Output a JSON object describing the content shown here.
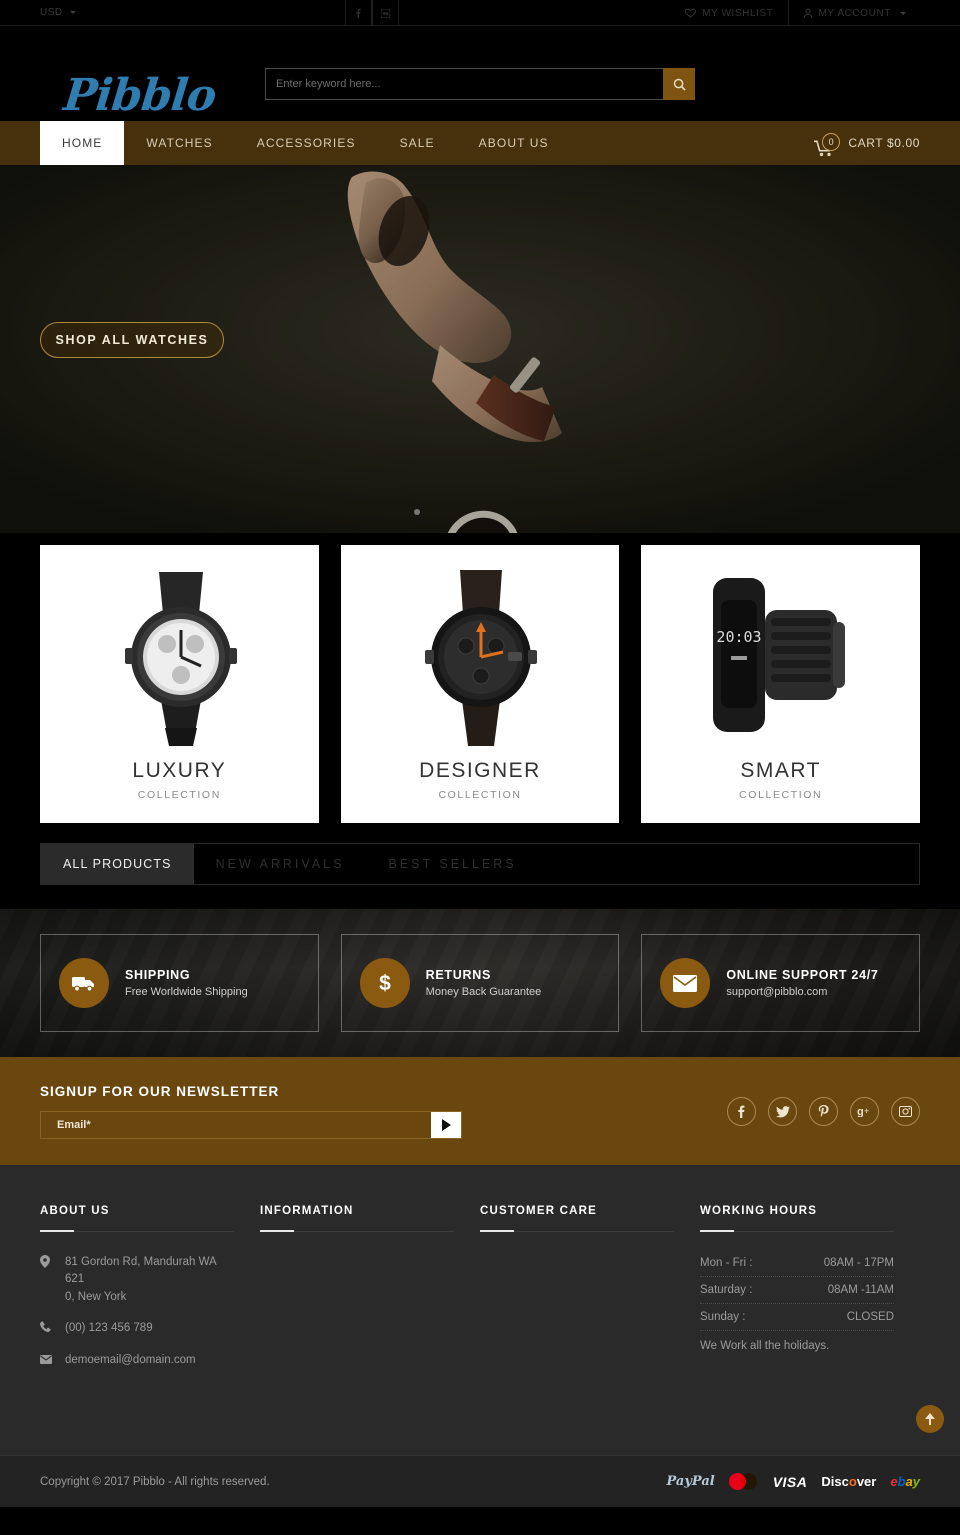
{
  "topbar": {
    "currency": "USD",
    "social": [
      "facebook-icon",
      "flickr-icon"
    ],
    "wishlist": "MY WISHLIST",
    "account": "MY ACCOUNT"
  },
  "header": {
    "logo": "Pibblo",
    "search": {
      "placeholder": "Enter keyword here...",
      "value": "",
      "icon": "search-icon"
    }
  },
  "nav": {
    "items": [
      {
        "label": "HOME",
        "active": true
      },
      {
        "label": "WATCHES",
        "active": false
      },
      {
        "label": "ACCESSORIES",
        "active": false
      },
      {
        "label": "SALE",
        "active": false
      },
      {
        "label": "ABOUT US",
        "active": false
      }
    ],
    "cart": {
      "count": "0",
      "label": "CART $0.00",
      "icon": "cart-icon"
    }
  },
  "hero": {
    "cta": "SHOP ALL WATCHES",
    "alt": "hands-holding-wrist-watch"
  },
  "collections": [
    {
      "title": "LUXURY",
      "subtitle": "COLLECTION",
      "art": "chronograph-steel-watch"
    },
    {
      "title": "DESIGNER",
      "subtitle": "COLLECTION",
      "art": "orange-accent-pilot-watch"
    },
    {
      "title": "SMART",
      "subtitle": "COLLECTION",
      "art": "fitness-band-smart-watch",
      "display_time": "20:03"
    }
  ],
  "product_tabs": [
    {
      "label": "ALL PRODUCTS",
      "active": true
    },
    {
      "label": "NEW ARRIVALS",
      "active": false
    },
    {
      "label": "BEST SELLERS",
      "active": false
    }
  ],
  "services": [
    {
      "icon": "truck-icon",
      "title": "SHIPPING",
      "subtitle": "Free Worldwide Shipping"
    },
    {
      "icon": "dollar-icon",
      "title": "RETURNS",
      "subtitle": "Money Back Guarantee"
    },
    {
      "icon": "envelope-icon",
      "title": "ONLINE SUPPORT 24/7",
      "subtitle": "support@pibblo.com"
    }
  ],
  "newsletter": {
    "title": "SIGNUP FOR OUR NEWSLETTER",
    "placeholder": "Email*",
    "value": "",
    "submit_icon": "arrow-right-icon",
    "socials": [
      "facebook-icon",
      "twitter-icon",
      "pinterest-icon",
      "google-plus-icon",
      "instagram-icon"
    ]
  },
  "footer": {
    "columns": [
      {
        "heading": "ABOUT US"
      },
      {
        "heading": "INFORMATION"
      },
      {
        "heading": "CUSTOMER CARE"
      },
      {
        "heading": "WORKING HOURS"
      }
    ],
    "about": {
      "address_line1": "81 Gordon Rd, Mandurah WA 621",
      "address_line2": "0, New York",
      "phone": "(00) 123 456 789",
      "email": "demoemail@domain.com",
      "icons": {
        "address": "location-pin-icon",
        "phone": "phone-icon",
        "email": "envelope-icon"
      }
    },
    "working_hours": [
      {
        "day": "Mon - Fri :",
        "time": "08AM - 17PM"
      },
      {
        "day": "Saturday :",
        "time": "08AM -11AM"
      },
      {
        "day": "Sunday :",
        "time": "CLOSED"
      }
    ],
    "working_note": "We Work all the holidays.",
    "scroll_top_icon": "arrow-up-icon"
  },
  "bottom": {
    "copyright": "Copyright © 2017 Pibblo - All rights reserved.",
    "payments": [
      "PayPal",
      "Mastercard",
      "VISA",
      "Discover",
      "ebay"
    ]
  },
  "colors": {
    "accent_brown": "#6b4710",
    "nav_brown": "#47300c",
    "icon_brown": "#8a5a11",
    "logo_blue": "#2e7cb0",
    "footer_bg": "#2a2a2a"
  }
}
